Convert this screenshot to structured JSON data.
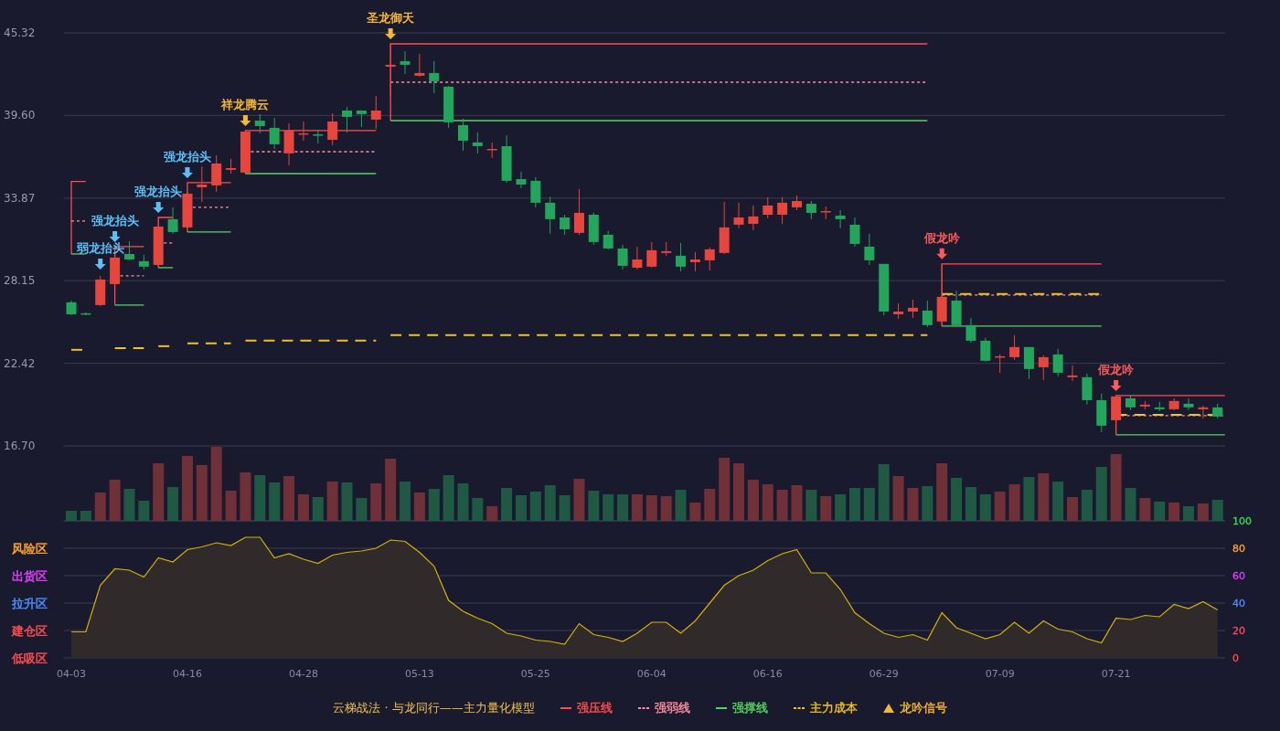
{
  "price_chart": {
    "chart_data": {
      "type": "candlestick",
      "ylim": [
        16.7,
        45.32
      ],
      "categories": [
        null,
        null,
        null,
        null,
        null,
        null,
        null,
        null,
        null,
        null,
        null,
        null,
        null,
        null,
        null,
        null,
        null,
        null,
        null,
        null,
        null,
        null,
        null,
        null,
        null,
        null,
        null,
        null,
        null,
        null,
        null,
        null,
        null,
        null,
        null,
        null,
        null,
        null,
        null,
        null,
        null,
        null,
        null,
        null,
        null,
        null,
        null,
        null,
        null,
        null,
        null,
        null,
        null,
        null,
        null,
        null,
        null,
        null,
        null,
        null,
        null,
        null,
        null,
        null,
        null,
        null,
        null,
        null,
        null,
        null,
        null,
        null,
        null,
        null,
        null,
        null,
        null,
        null,
        null,
        null
      ],
      "yticks": [
        {
          "value": 45.32,
          "label": "45.32"
        },
        {
          "value": 39.6,
          "label": "39.60"
        },
        {
          "value": 33.87,
          "label": "33.87"
        },
        {
          "value": 28.15,
          "label": "28.15"
        },
        {
          "value": 22.42,
          "label": "22.42"
        },
        {
          "value": 16.7,
          "label": "16.70"
        }
      ],
      "ohlc": [
        [
          26.65,
          26.77,
          25.76,
          25.82
        ],
        [
          25.89,
          25.95,
          25.76,
          25.82
        ],
        [
          26.46,
          28.48,
          26.39,
          28.23
        ],
        [
          27.91,
          30.0,
          27.79,
          29.75
        ],
        [
          30.0,
          30.89,
          29.56,
          29.62
        ],
        [
          29.5,
          29.94,
          28.93,
          29.12
        ],
        [
          29.24,
          32.09,
          29.18,
          31.9
        ],
        [
          32.41,
          33.23,
          31.4,
          31.52
        ],
        [
          31.84,
          34.31,
          31.78,
          34.18
        ],
        [
          34.62,
          36.08,
          33.61,
          34.81
        ],
        [
          34.75,
          36.84,
          34.31,
          36.27
        ],
        [
          35.83,
          36.59,
          35.57,
          35.95
        ],
        [
          35.64,
          38.48,
          35.64,
          38.48
        ],
        [
          39.24,
          39.69,
          38.36,
          38.86
        ],
        [
          38.74,
          39.43,
          37.28,
          37.6
        ],
        [
          36.97,
          39.05,
          36.14,
          38.55
        ],
        [
          38.29,
          39.18,
          37.85,
          38.36
        ],
        [
          38.29,
          38.61,
          37.66,
          38.23
        ],
        [
          37.91,
          39.75,
          37.54,
          39.18
        ],
        [
          39.94,
          40.19,
          38.42,
          39.5
        ],
        [
          39.94,
          39.94,
          38.8,
          39.69
        ],
        [
          39.31,
          40.95,
          38.67,
          39.94
        ],
        [
          42.98,
          44.56,
          40.95,
          43.11
        ],
        [
          43.36,
          44.06,
          42.47,
          43.11
        ],
        [
          42.35,
          43.87,
          42.28,
          42.54
        ],
        [
          42.54,
          43.36,
          41.14,
          41.97
        ],
        [
          41.59,
          41.65,
          38.74,
          39.12
        ],
        [
          38.93,
          39.37,
          37.16,
          37.85
        ],
        [
          37.73,
          38.42,
          36.97,
          37.47
        ],
        [
          37.22,
          37.73,
          36.65,
          37.28
        ],
        [
          37.47,
          38.23,
          34.94,
          35.07
        ],
        [
          35.19,
          35.7,
          34.56,
          34.81
        ],
        [
          35.07,
          35.32,
          33.23,
          33.55
        ],
        [
          33.55,
          33.99,
          31.4,
          32.41
        ],
        [
          32.53,
          32.72,
          31.33,
          31.71
        ],
        [
          31.46,
          34.5,
          31.33,
          32.85
        ],
        [
          32.72,
          32.85,
          30.64,
          30.83
        ],
        [
          31.33,
          31.59,
          30.32,
          30.38
        ],
        [
          30.38,
          30.64,
          28.93,
          29.18
        ],
        [
          29.05,
          30.51,
          28.93,
          29.62
        ],
        [
          29.12,
          30.83,
          29.05,
          30.26
        ],
        [
          30.07,
          30.83,
          29.88,
          30.19
        ],
        [
          29.88,
          30.76,
          28.8,
          29.12
        ],
        [
          29.43,
          30.13,
          28.8,
          29.62
        ],
        [
          29.56,
          30.45,
          28.86,
          30.32
        ],
        [
          30.07,
          33.61,
          30.0,
          31.84
        ],
        [
          32.03,
          33.55,
          31.78,
          32.53
        ],
        [
          32.09,
          33.36,
          31.65,
          32.6
        ],
        [
          32.72,
          33.93,
          32.47,
          33.36
        ],
        [
          32.72,
          33.93,
          32.09,
          33.55
        ],
        [
          33.23,
          34.05,
          33.04,
          33.67
        ],
        [
          33.48,
          33.67,
          32.41,
          32.85
        ],
        [
          32.91,
          33.29,
          32.41,
          32.97
        ],
        [
          32.66,
          33.04,
          31.78,
          32.41
        ],
        [
          32.03,
          32.53,
          30.51,
          30.7
        ],
        [
          30.51,
          31.4,
          29.24,
          29.56
        ],
        [
          29.31,
          29.31,
          25.76,
          26.01
        ],
        [
          25.82,
          26.58,
          25.51,
          26.01
        ],
        [
          26.01,
          26.84,
          25.57,
          26.27
        ],
        [
          26.08,
          26.77,
          24.94,
          25.07
        ],
        [
          25.32,
          29.31,
          25.07,
          27.03
        ],
        [
          26.77,
          27.47,
          25.0,
          25.07
        ],
        [
          25.07,
          25.57,
          23.86,
          23.99
        ],
        [
          23.99,
          24.18,
          22.53,
          22.6
        ],
        [
          22.85,
          23.04,
          21.77,
          22.91
        ],
        [
          22.85,
          24.37,
          22.66,
          23.55
        ],
        [
          23.55,
          23.55,
          21.33,
          22.03
        ],
        [
          22.15,
          22.98,
          21.27,
          22.85
        ],
        [
          23.04,
          23.42,
          21.52,
          21.77
        ],
        [
          21.46,
          22.28,
          21.2,
          21.58
        ],
        [
          21.46,
          21.71,
          19.56,
          19.87
        ],
        [
          19.87,
          20.32,
          17.66,
          18.1
        ],
        [
          18.48,
          20.25,
          18.1,
          20.13
        ],
        [
          20.0,
          20.25,
          19.18,
          19.37
        ],
        [
          19.43,
          19.81,
          19.24,
          19.56
        ],
        [
          19.37,
          19.75,
          19.11,
          19.24
        ],
        [
          19.24,
          20.0,
          19.18,
          19.81
        ],
        [
          19.62,
          20.0,
          19.18,
          19.37
        ],
        [
          19.24,
          19.49,
          18.61,
          19.37
        ],
        [
          19.37,
          19.62,
          18.61,
          18.74
        ]
      ],
      "annotations": [
        "弱龙抬头",
        "强龙抬头",
        "强龙抬头",
        "强龙抬头",
        "祥龙腾云",
        "圣龙御天",
        "假龙吟",
        "假龙吟"
      ]
    },
    "signal_colors": [
      {
        "color": "#5bc0f8"
      },
      {
        "color": "#5bc0f8"
      },
      {
        "color": "#5bc0f8"
      },
      {
        "color": "#5bc0f8"
      },
      {
        "color": "#f5b82e"
      },
      {
        "color": "#f5b82e"
      },
      {
        "color": "#ff5a5a"
      },
      {
        "color": "#ff5a5a"
      }
    ]
  },
  "indicator_chart": {
    "zones": [
      {
        "label": "风险区",
        "color": "#ffa42b"
      },
      {
        "label": "出货区",
        "color": "#e040fb"
      },
      {
        "label": "拉升区",
        "color": "#4e8cff"
      },
      {
        "label": "建仓区",
        "color": "#ff4d4f"
      },
      {
        "label": "低吸区",
        "color": "#ff4d4f"
      }
    ],
    "tick_colors": [
      {
        "color": "#33dd55"
      },
      {
        "color": "#ffa42b"
      },
      {
        "color": "#e040fb"
      },
      {
        "color": "#4e8cff"
      },
      {
        "color": "#ff4d4f"
      },
      {
        "color": "#ff4d4f"
      }
    ],
    "chart_data": {
      "type": "area",
      "ylim": [
        0,
        100
      ],
      "categories": [
        "04-03",
        null,
        null,
        null,
        null,
        null,
        null,
        null,
        "04-16",
        null,
        null,
        null,
        null,
        null,
        null,
        null,
        "04-28",
        null,
        null,
        null,
        null,
        null,
        null,
        null,
        "05-13",
        null,
        null,
        null,
        null,
        null,
        null,
        null,
        "05-25",
        null,
        null,
        null,
        null,
        null,
        null,
        null,
        "06-04",
        null,
        null,
        null,
        null,
        null,
        null,
        null,
        "06-16",
        null,
        null,
        null,
        null,
        null,
        null,
        null,
        "06-29",
        null,
        null,
        null,
        null,
        null,
        null,
        null,
        "07-09",
        null,
        null,
        null,
        null,
        null,
        null,
        null,
        "07-21",
        null,
        null,
        null,
        null,
        null,
        null,
        null
      ],
      "yticks": [
        {
          "value": 100,
          "label": "100"
        },
        {
          "value": 80,
          "label": "80"
        },
        {
          "value": 60,
          "label": "60"
        },
        {
          "value": 40,
          "label": "40"
        },
        {
          "value": 20,
          "label": "20"
        },
        {
          "value": 0,
          "label": "0"
        }
      ],
      "values": [
        19,
        19,
        53,
        65,
        64,
        59,
        73,
        70,
        79,
        81,
        84,
        82,
        88,
        88,
        73,
        76,
        72,
        69,
        75,
        77,
        78,
        80,
        86,
        85,
        77,
        67,
        42,
        34,
        29,
        25,
        18,
        16,
        13,
        12,
        10,
        25,
        17,
        15,
        12,
        18,
        26,
        26,
        18,
        27,
        40,
        53,
        60,
        64,
        71,
        76,
        79,
        62,
        62,
        50,
        33,
        25,
        18,
        15,
        17,
        13,
        33,
        22,
        18,
        14,
        17,
        26,
        18,
        27,
        21,
        19,
        14,
        11,
        29,
        28,
        31,
        30,
        39,
        36,
        41,
        35
      ]
    }
  },
  "legend": {
    "title": "云梯战法 · 与龙同行——主力量化模型",
    "items": [
      {
        "kind": "solid",
        "label": "强压线",
        "color": "#ff4d4f"
      },
      {
        "kind": "dashed",
        "label": "强弱线",
        "color": "#ff8f9f"
      },
      {
        "kind": "solid",
        "label": "强撑线",
        "color": "#55d45f"
      },
      {
        "kind": "dashed",
        "label": "主力成本",
        "color": "#f0c419"
      },
      {
        "kind": "triangle",
        "label": "龙吟信号",
        "color": "#f5b82e"
      }
    ]
  }
}
